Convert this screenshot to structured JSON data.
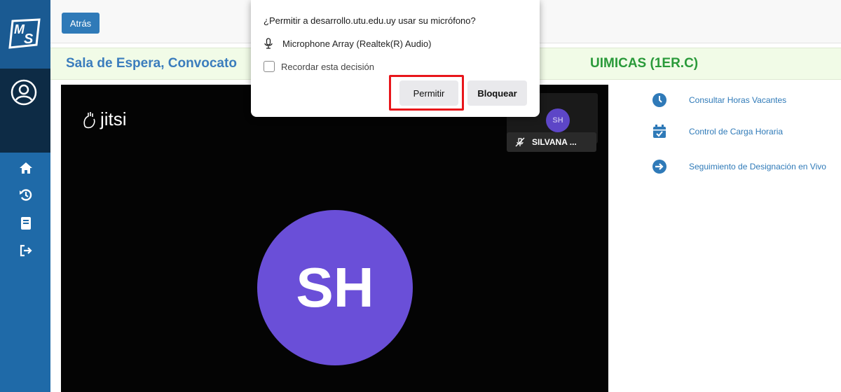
{
  "sidebar": {
    "logo_text": "MS",
    "nav": [
      {
        "icon": "home-icon"
      },
      {
        "icon": "history-icon"
      },
      {
        "icon": "book-icon"
      },
      {
        "icon": "logout-icon"
      }
    ]
  },
  "topbar": {
    "back_label": "Atrás"
  },
  "banner": {
    "title_left": "Sala de Espera, Convocato",
    "title_right": "UIMICAS (1ER.C)"
  },
  "video": {
    "brand": "jitsi",
    "participant_name": "SILVANA ...",
    "participant_initials": "SH",
    "thumb_initials": "SH"
  },
  "links": [
    {
      "icon": "clock-icon",
      "label": "Consultar Horas Vacantes"
    },
    {
      "icon": "calendar-check-icon",
      "label": "Control de Carga Horaria"
    },
    {
      "icon": "arrow-right-circle-icon",
      "label": "Seguimiento de Designación en Vivo"
    }
  ],
  "popup": {
    "question": "¿Permitir a desarrollo.utu.edu.uy usar su micrófono?",
    "device": "Microphone Array (Realtek(R) Audio)",
    "remember_label": "Recordar esta decisión",
    "allow_label": "Permitir",
    "block_label": "Bloquear"
  },
  "colors": {
    "sidebar": "#1f6aa8",
    "accent_blue": "#3b7dbd",
    "accent_green": "#2a9a3a",
    "avatar_purple": "#6a4fd8",
    "highlight_red": "#e8161b"
  }
}
